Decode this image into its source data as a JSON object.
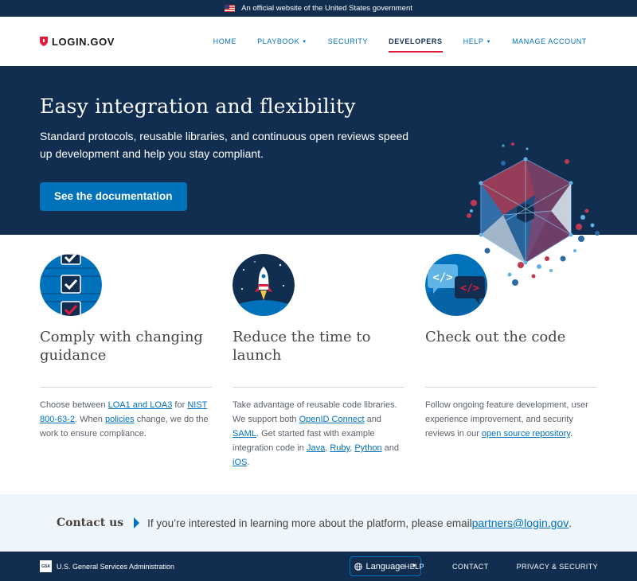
{
  "gov_banner": {
    "text": "An official website of the United States government"
  },
  "header": {
    "logo": "LOGIN.GOV",
    "nav": [
      {
        "label": "HOME"
      },
      {
        "label": "PLAYBOOK"
      },
      {
        "label": "SECURITY"
      },
      {
        "label": "DEVELOPERS"
      },
      {
        "label": "HELP"
      },
      {
        "label": "MANAGE ACCOUNT"
      }
    ],
    "active": "DEVELOPERS"
  },
  "hero": {
    "title": "Easy integration and flexibility",
    "subtitle": "Standard protocols, reusable libraries, and continuous open reviews speed up development and help you stay compliant.",
    "cta": "See the documentation"
  },
  "features": [
    {
      "icon": "checklist-icon",
      "title": "Comply with changing guidance",
      "p_before": "Choose between ",
      "link1": "LOA1 and LOA3",
      "p_mid1": " for ",
      "link2": "NIST 800-63-2",
      "p_mid2": ". When ",
      "link3": "policies",
      "p_after": " change, we do the work to ensure compliance."
    },
    {
      "icon": "rocket-icon",
      "title": "Reduce the time to launch",
      "p_before": "Take advantage of reusable code libraries. We support both ",
      "link1": "OpenID Connect",
      "p_mid1": " and ",
      "link2": "SAML",
      "p_mid2": ". Get started fast with example integration code in ",
      "link3": "Java",
      "sep1": ", ",
      "link4": "Ruby",
      "sep2": ", ",
      "link5": "Python",
      "sep3": " and ",
      "link6": "iOS",
      "p_after": "."
    },
    {
      "icon": "code-icon",
      "title": "Check out the code",
      "p_before": "Follow ongoing feature development, user experience improvement, and security reviews in our ",
      "link1": "open source repository",
      "p_after": "."
    }
  ],
  "contact": {
    "title": "Contact us",
    "text": "If you’re interested in learning more about the platform, please email ",
    "email": "partners@login.gov",
    "end": "."
  },
  "footer": {
    "agency": "U.S. General Services Administration",
    "gsa_logo": "GSA",
    "language": "Language",
    "links": [
      "HELP",
      "CONTACT",
      "PRIVACY & SECURITY"
    ]
  },
  "colors": {
    "navy": "#112e51",
    "blue": "#0071bb",
    "red": "#e21c3d",
    "light_bg": "#eff6fb"
  }
}
